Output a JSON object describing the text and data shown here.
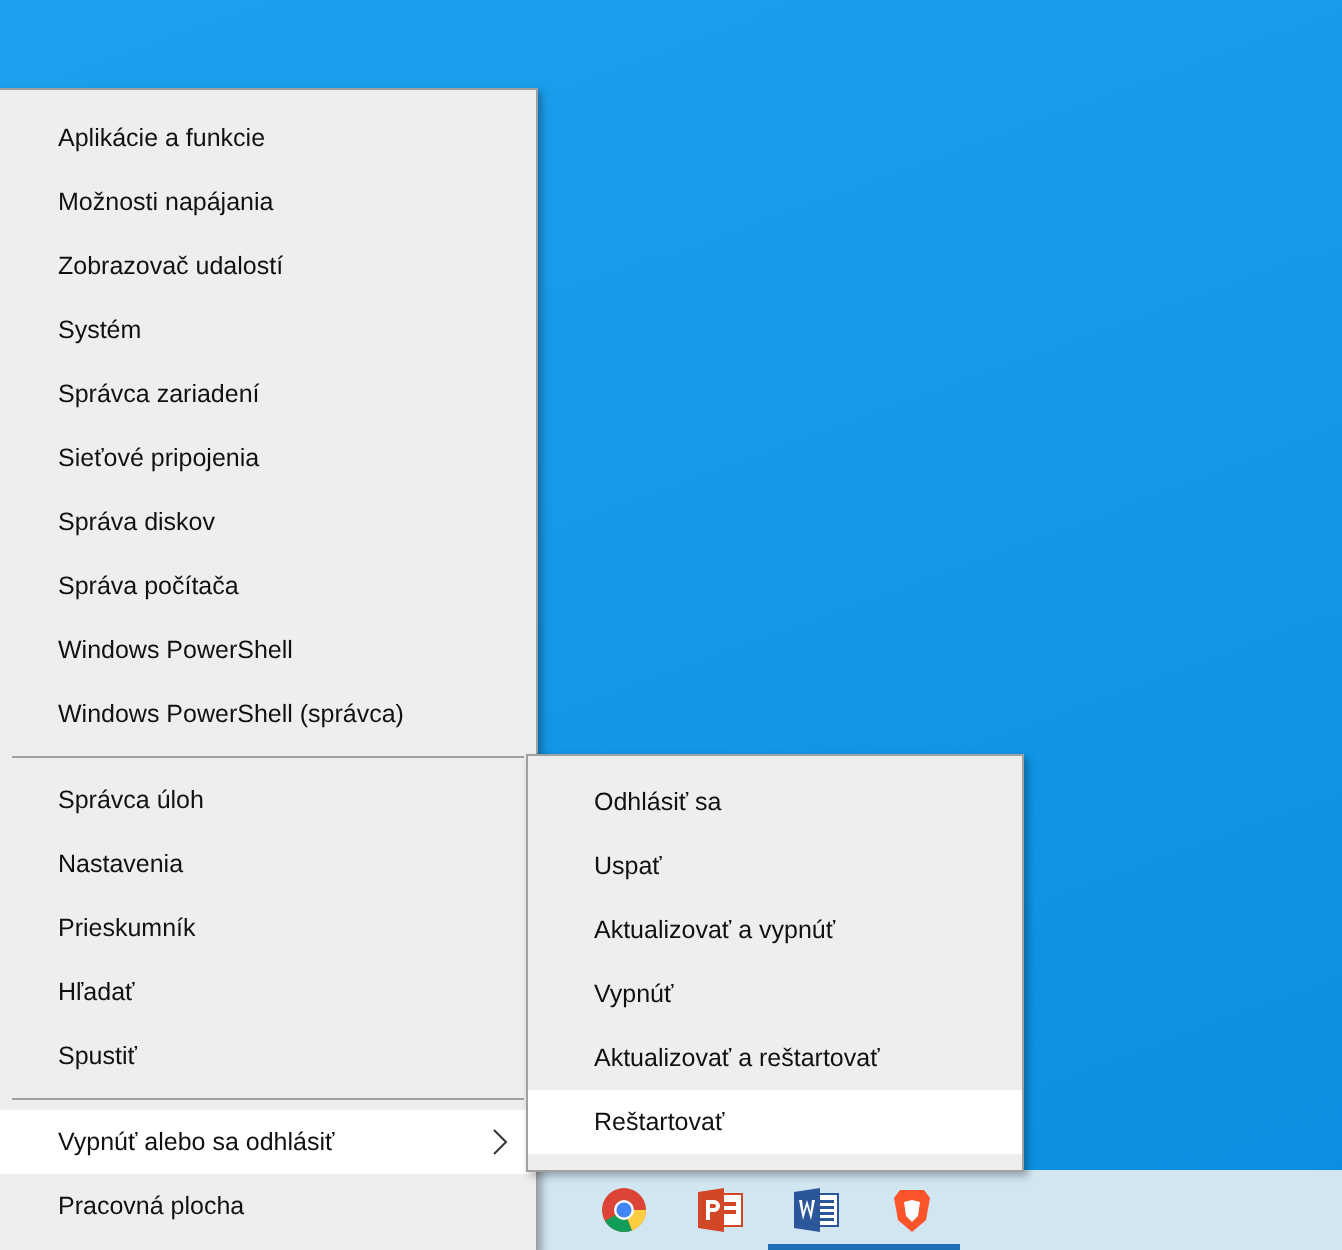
{
  "menu": {
    "groups": [
      [
        {
          "label": "Aplikácie a funkcie",
          "selected": false
        },
        {
          "label": "Možnosti napájania",
          "selected": false
        },
        {
          "label": "Zobrazovač udalostí",
          "selected": false
        },
        {
          "label": "Systém",
          "selected": false
        },
        {
          "label": "Správca zariadení",
          "selected": false
        },
        {
          "label": "Sieťové pripojenia",
          "selected": false
        },
        {
          "label": "Správa diskov",
          "selected": false
        },
        {
          "label": "Správa počítača",
          "selected": false
        },
        {
          "label": "Windows PowerShell",
          "selected": false
        },
        {
          "label": "Windows PowerShell (správca)",
          "selected": false
        }
      ],
      [
        {
          "label": "Správca úloh",
          "selected": false
        },
        {
          "label": "Nastavenia",
          "selected": false
        },
        {
          "label": "Prieskumník",
          "selected": false
        },
        {
          "label": "Hľadať",
          "selected": false
        },
        {
          "label": "Spustiť",
          "selected": false
        }
      ],
      [
        {
          "label": "Vypnúť alebo sa odhlásiť",
          "selected": true,
          "expanded": true
        },
        {
          "label": "Pracovná plocha",
          "selected": false
        }
      ]
    ]
  },
  "submenu": {
    "items": [
      {
        "label": "Odhlásiť sa",
        "selected": false
      },
      {
        "label": "Uspať",
        "selected": false
      },
      {
        "label": "Aktualizovať a vypnúť",
        "selected": false
      },
      {
        "label": "Vypnúť",
        "selected": false
      },
      {
        "label": "Aktualizovať a reštartovať",
        "selected": false
      },
      {
        "label": "Reštartovať",
        "selected": true
      }
    ]
  },
  "taskbar": {
    "apps": [
      {
        "kind": "browser",
        "running": false
      },
      {
        "kind": "slides",
        "running": false
      },
      {
        "kind": "document",
        "running": true
      },
      {
        "kind": "shield",
        "running": true
      }
    ]
  }
}
